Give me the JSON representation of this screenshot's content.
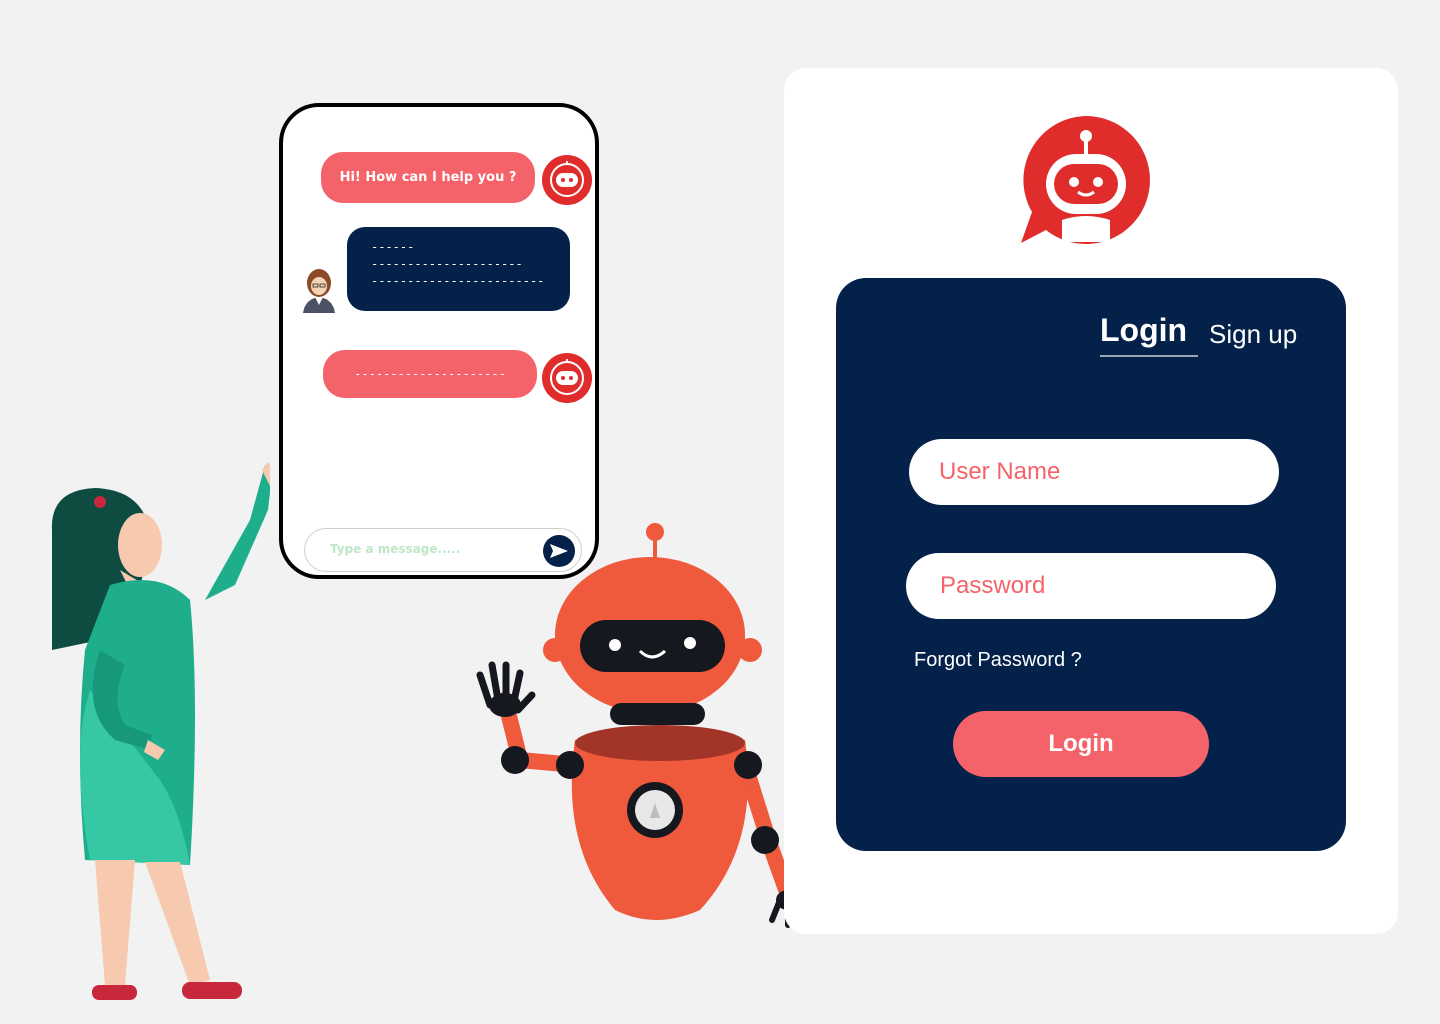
{
  "chat": {
    "bot_greeting": "Hi!  How can I help you ?",
    "user_reply": "------\n---------------------\n------------------------",
    "bot_reply": "---------------------",
    "input_placeholder": "Type a message....."
  },
  "auth": {
    "tabs": {
      "login": "Login",
      "signup": "Sign up"
    },
    "username_placeholder": "User Name",
    "password_placeholder": "Password",
    "forgot_password": "Forgot Password ?",
    "submit_label": "Login"
  },
  "colors": {
    "background": "#f2f2f2",
    "navy": "#04214a",
    "coral": "#f5636a",
    "bot_red": "#e12c2c",
    "robot_orange": "#ef5a3c"
  },
  "icons": [
    "bot-avatar-icon",
    "user-avatar-icon",
    "send-icon",
    "chatbot-logo-icon"
  ]
}
